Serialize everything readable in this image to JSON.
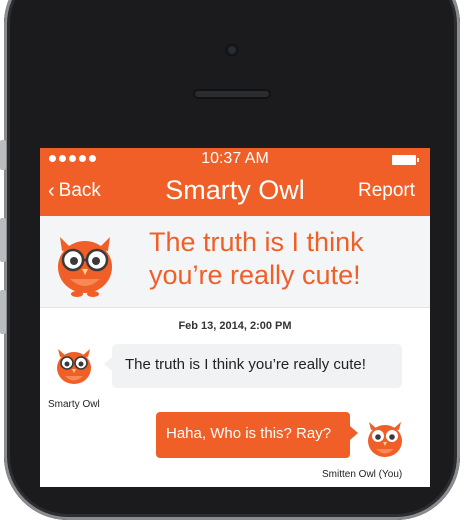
{
  "status_bar": {
    "time": "10:37 AM",
    "signal_dots": 5
  },
  "nav": {
    "back_label": "Back",
    "title": "Smarty Owl",
    "report_label": "Report"
  },
  "banner": {
    "message": "The truth is I think you’re really cute!"
  },
  "chat": {
    "timestamp": "Feb 13, 2014, 2:00 PM",
    "messages": [
      {
        "sender": "Smarty Owl",
        "text": "The truth is I  think you’re really cute!"
      },
      {
        "sender": "Smitten  Owl (You)",
        "text": "Haha, Who is this? Ray?"
      }
    ]
  },
  "colors": {
    "accent": "#ef5f27",
    "bubble_in": "#f1f2f4",
    "banner_bg": "#f4f5f7"
  }
}
